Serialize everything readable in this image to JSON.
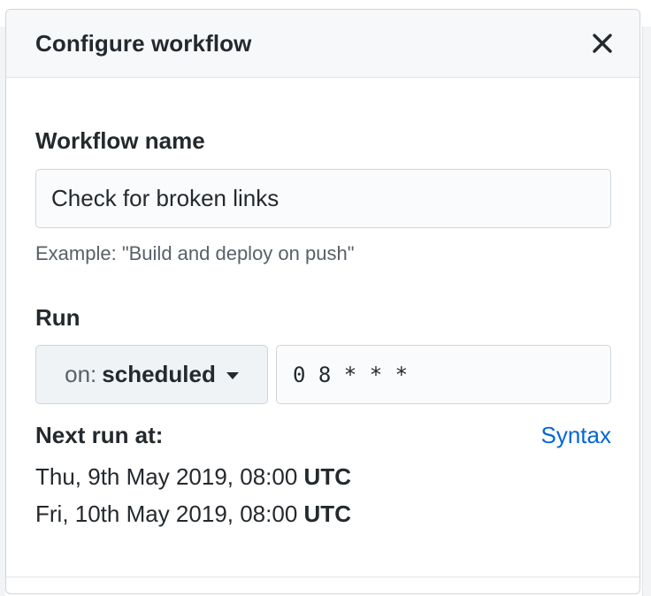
{
  "dialog": {
    "title": "Configure workflow",
    "close_icon": "close-icon"
  },
  "workflow_name": {
    "label": "Workflow name",
    "value": "Check for broken links",
    "note": "Example: \"Build and deploy on push\""
  },
  "run": {
    "label": "Run",
    "trigger_prefix": "on:",
    "trigger_value": "scheduled",
    "caret_icon": "caret-down-icon",
    "cron_value": "0 8 * * *",
    "next_run_label": "Next run at:",
    "syntax_link": "Syntax",
    "next_runs": [
      {
        "datetime": "Thu, 9th May 2019, 08:00",
        "tz": "UTC"
      },
      {
        "datetime": "Fri, 10th May 2019, 08:00",
        "tz": "UTC"
      }
    ]
  },
  "colors": {
    "link": "#0366d6",
    "header_bg": "#f6f8fa",
    "border": "#d1d5da",
    "select_bg": "#eff3f6"
  }
}
